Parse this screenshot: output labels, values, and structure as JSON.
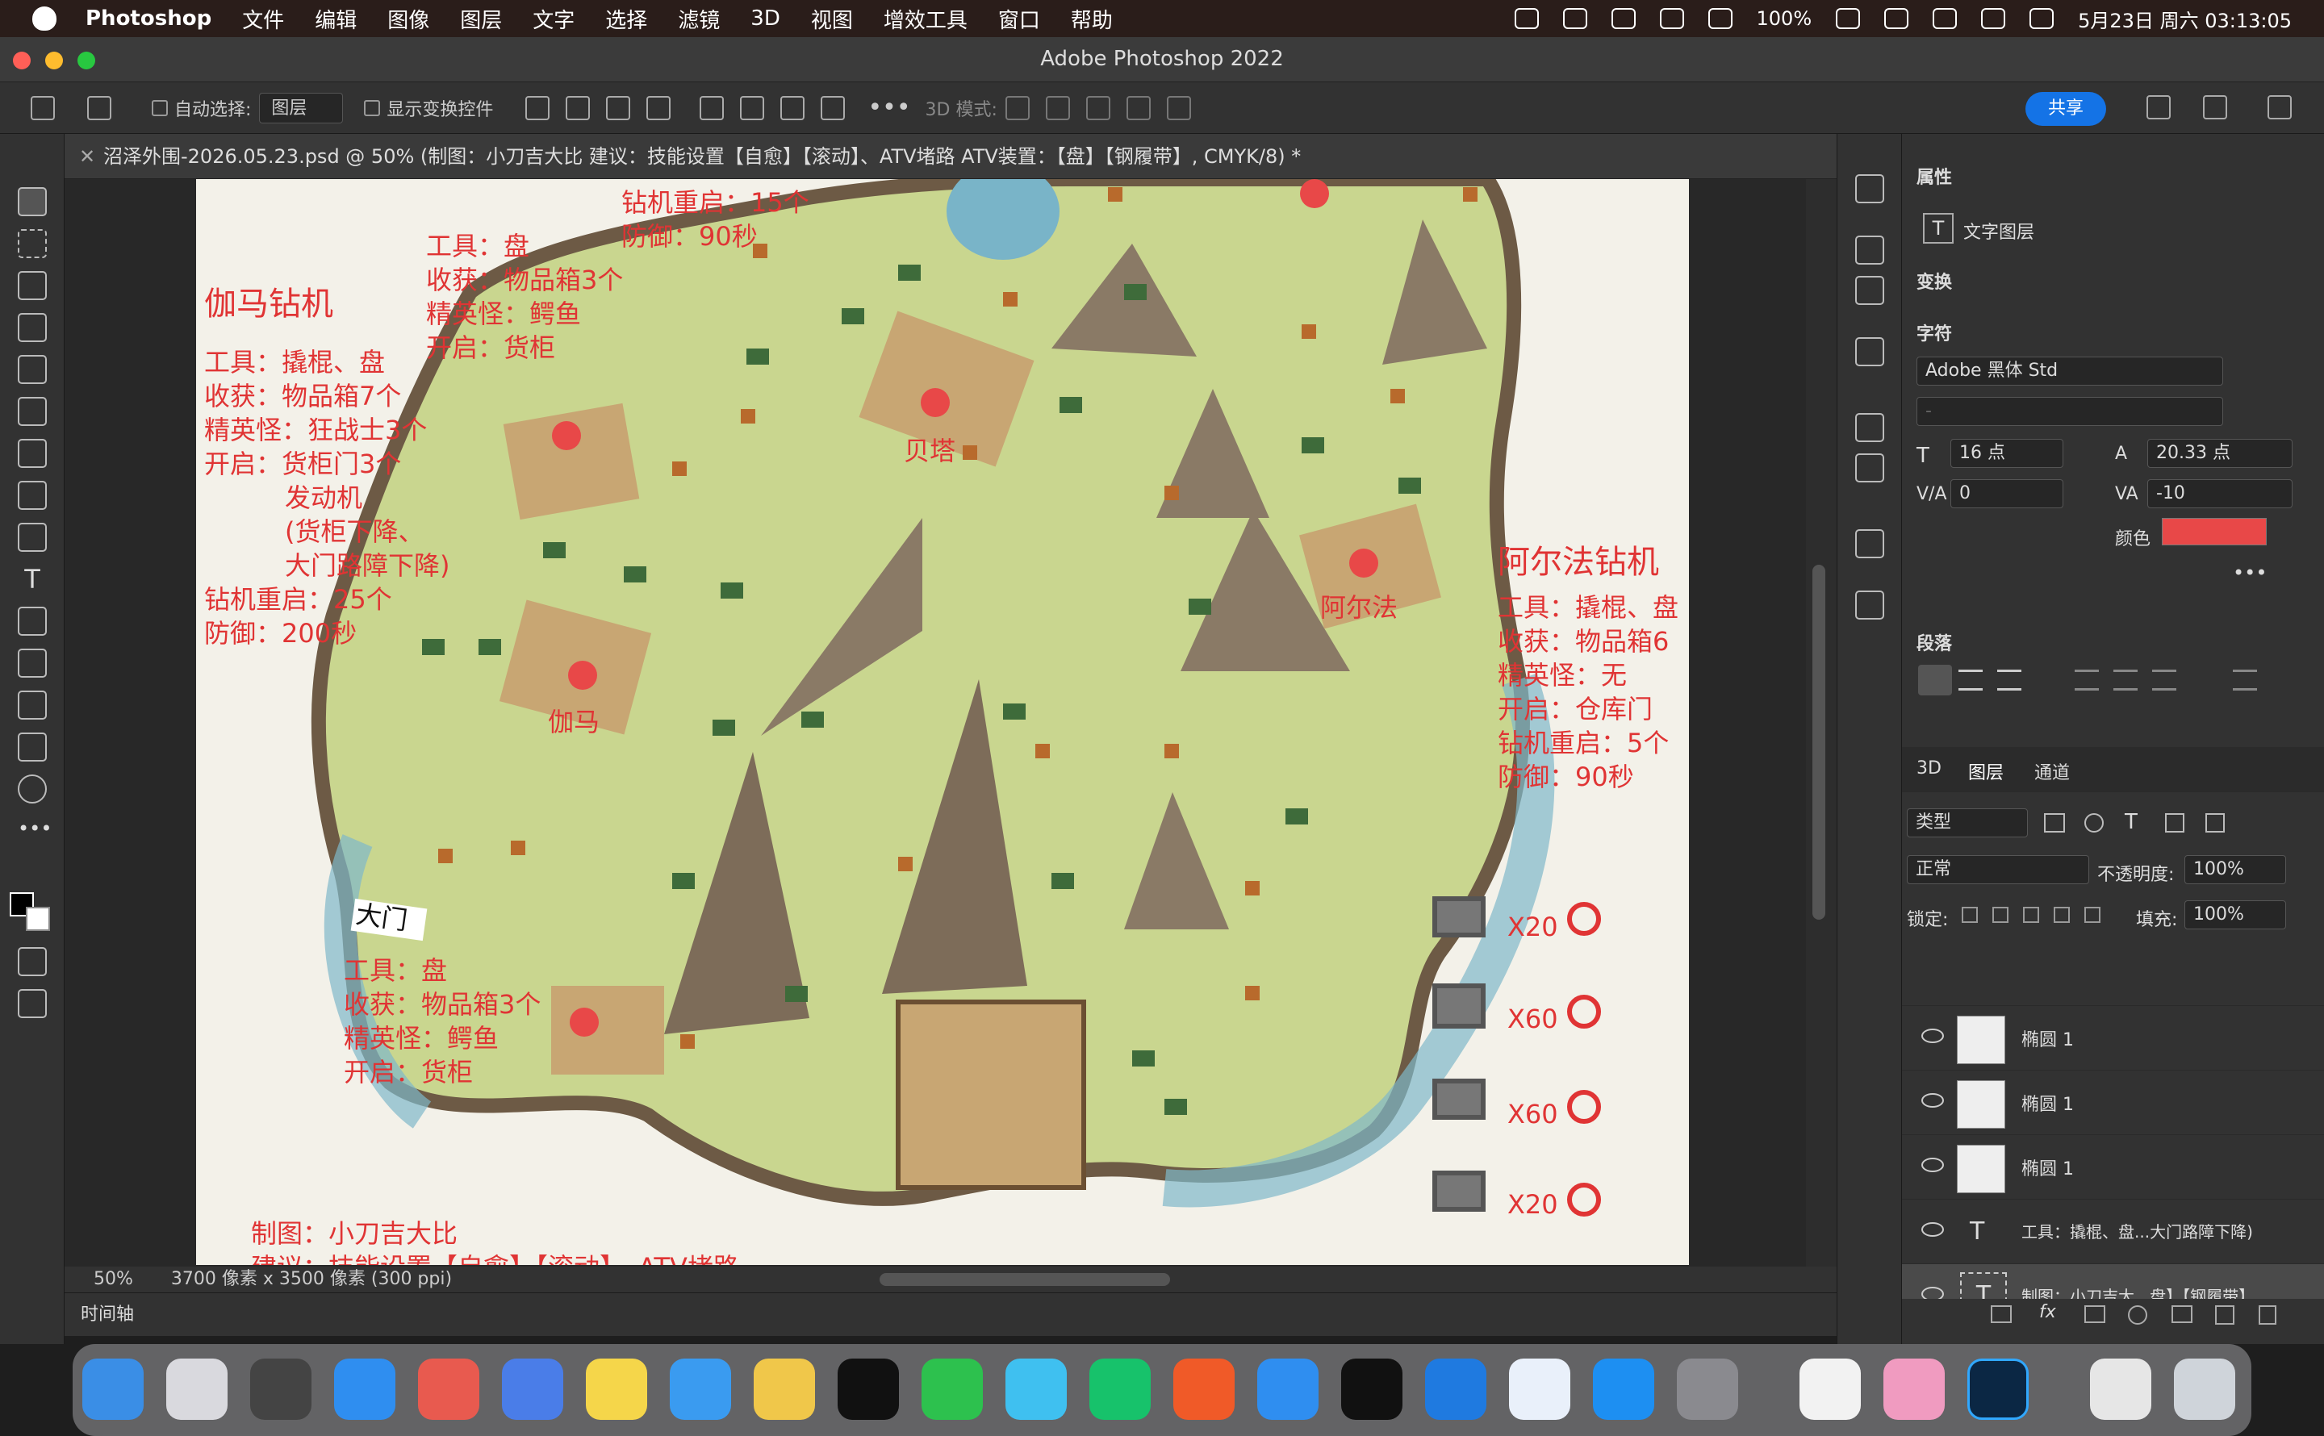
{
  "menubar": {
    "app": "Photoshop",
    "items": [
      "文件",
      "编辑",
      "图像",
      "图层",
      "文字",
      "选择",
      "滤镜",
      "3D",
      "视图",
      "增效工具",
      "窗口",
      "帮助"
    ],
    "battery": "100%",
    "datetime": "5月23日 周六 03:13:05"
  },
  "window": {
    "title": "Adobe Photoshop 2022"
  },
  "options": {
    "auto_select_label": "自动选择:",
    "auto_select_value": "图层",
    "show_transform_label": "显示变换控件",
    "mode3d_label": "3D 模式:",
    "share_label": "共享"
  },
  "document": {
    "tab_title": "沼泽外围-2026.05.23.psd @ 50% (制图：小刀吉大比 建议：技能设置【自愈】【滚动】、ATV堵路 ATV装置：【盘】【钢履带】, CMYK/8) *",
    "zoom": "50%",
    "dimensions": "3700 像素 x 3500 像素 (300 ppi)"
  },
  "timeline_label": "时间轴",
  "map": {
    "top_center": [
      "钻机重启：15个",
      "防御：90秒"
    ],
    "upper_mid": [
      "工具：盘",
      "收获：物品箱3个",
      "精英怪：鳄鱼",
      "开启：货柜"
    ],
    "gamma_title": "伽马钻机",
    "gamma_lines": [
      "工具：撬棍、盘",
      "收获：物品箱7个",
      "精英怪：狂战士3个",
      "开启：货柜门3个",
      "发动机",
      "(货柜下降、",
      "大门路障下降)",
      "钻机重启：25个",
      "防御：200秒"
    ],
    "alpha_title": "阿尔法钻机",
    "alpha_lines": [
      "工具：撬棍、盘",
      "收获：物品箱6",
      "精英怪：无",
      "开启：仓库门",
      "钻机重启：5个",
      "防御：90秒"
    ],
    "lower_left": [
      "工具：盘",
      "收获：物品箱3个",
      "精英怪：鳄鱼",
      "开启：货柜"
    ],
    "gate_label": "大门",
    "label_beta": "贝塔",
    "label_alpha": "阿尔法",
    "label_gamma": "伽马",
    "credits": [
      "制图：小刀吉大比",
      "建议：技能设置【自愈】【滚动】、ATV堵路"
    ],
    "legend": [
      "X20",
      "X60",
      "X60",
      "X20"
    ]
  },
  "properties": {
    "title": "属性",
    "layer_type": "文字图层",
    "transform": "变换",
    "character": "字符",
    "font_family": "Adobe 黑体 Std",
    "font_style": "-",
    "font_size": "16 点",
    "leading": "20.33 点",
    "kerning": "0",
    "tracking": "-10",
    "color_label": "颜色",
    "color_swatch": "#e84848",
    "paragraph": "段落"
  },
  "layers_panel": {
    "tabs": [
      "3D",
      "图层",
      "通道"
    ],
    "kind_filter": "类型",
    "blend_mode": "正常",
    "opacity_label": "不透明度:",
    "opacity": "100%",
    "lock_label": "锁定:",
    "fill_label": "填充:",
    "fill": "100%",
    "layers": [
      "椭圆 1",
      "椭圆 1",
      "椭圆 1",
      "工具：撬棍、盘...大门路障下降)",
      "制图：小刀吉大...盘】【钢履带】"
    ]
  }
}
